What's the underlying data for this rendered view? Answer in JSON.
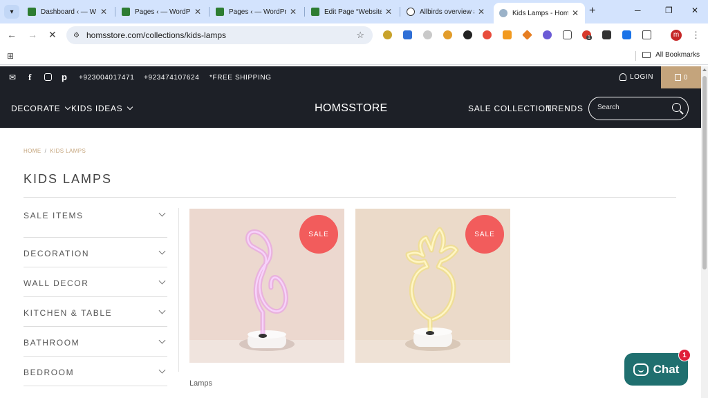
{
  "browser": {
    "tabs": [
      {
        "label": "Dashboard ‹ — W",
        "favicon": "site-favicon-green",
        "active": false
      },
      {
        "label": "Pages ‹ — WordPr",
        "favicon": "site-favicon-green",
        "active": false
      },
      {
        "label": "Pages ‹ — WordPr",
        "favicon": "site-favicon-green",
        "active": false
      },
      {
        "label": "Edit Page “Website",
        "favicon": "site-favicon-green",
        "active": false
      },
      {
        "label": "Allbirds overview a",
        "favicon": "openai-icon",
        "active": false
      },
      {
        "label": "Kids Lamps - Hom",
        "favicon": "homsstore-icon",
        "active": true
      }
    ],
    "url": "homsstore.com/collections/kids-lamps",
    "extension_badge": "1",
    "profile_initial": "m",
    "bookmarks_label": "All Bookmarks"
  },
  "topbar": {
    "phone1": "+923004017471",
    "phone2": "+923474107624",
    "shipping": "*FREE SHIPPING",
    "login": "LOGIN",
    "cart_count": "0"
  },
  "header": {
    "nav_left": [
      "DECORATE",
      "KIDS IDEAS"
    ],
    "logo": "HOMSSTORE",
    "nav_right": [
      "SALE COLLECTION",
      "TRENDS"
    ],
    "search_placeholder": "Search"
  },
  "breadcrumb": {
    "home": "HOME",
    "separator": "/",
    "current": "KIDS LAMPS"
  },
  "page_title": "KIDS LAMPS",
  "sidebar": {
    "categories": [
      "SALE ITEMS",
      "DECORATION",
      "WALL DECOR",
      "KITCHEN & TABLE",
      "BATHROOM",
      "BEDROOM"
    ]
  },
  "products": [
    {
      "badge": "SALE",
      "image": "pink neon flamingo lamp",
      "title": "Lamps"
    },
    {
      "badge": "SALE",
      "image": "yellow neon pineapple lamp"
    }
  ],
  "chat": {
    "label": "Chat",
    "badge": "1"
  },
  "colors": {
    "accent_gold": "#c4a47c",
    "header_dark": "#1d2027",
    "sale_red": "#f25c5c",
    "chat_teal": "#1f6f6f"
  }
}
